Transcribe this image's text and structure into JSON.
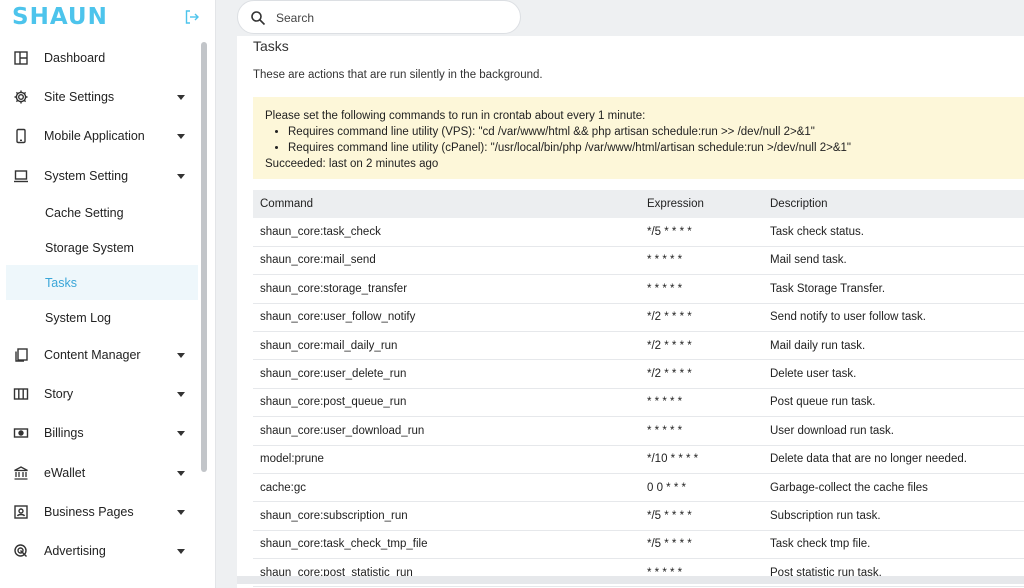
{
  "app": {
    "logo_text": "SHAUN",
    "accent_color": "#4dc4ec",
    "active_color": "#3aa6d8"
  },
  "search": {
    "placeholder": "Search",
    "icon": "search-icon"
  },
  "sidebar": {
    "items": [
      {
        "label": "Dashboard",
        "icon": "dashboard-icon",
        "has_caret": false
      },
      {
        "label": "Site Settings",
        "icon": "gear-icon",
        "has_caret": true
      },
      {
        "label": "Mobile Application",
        "icon": "mobile-icon",
        "has_caret": true
      },
      {
        "label": "System Setting",
        "icon": "laptop-icon",
        "has_caret": true,
        "expanded": true
      },
      {
        "label": "Content Manager",
        "icon": "copy-icon",
        "has_caret": true
      },
      {
        "label": "Story",
        "icon": "columns-icon",
        "has_caret": true
      },
      {
        "label": "Billings",
        "icon": "money-icon",
        "has_caret": true
      },
      {
        "label": "eWallet",
        "icon": "bank-icon",
        "has_caret": true
      },
      {
        "label": "Business Pages",
        "icon": "id-card-icon",
        "has_caret": true
      },
      {
        "label": "Advertising",
        "icon": "target-icon",
        "has_caret": true
      }
    ],
    "system_setting_children": [
      {
        "label": "Cache Setting",
        "active": false
      },
      {
        "label": "Storage System",
        "active": false
      },
      {
        "label": "Tasks",
        "active": true
      },
      {
        "label": "System Log",
        "active": false
      }
    ]
  },
  "page": {
    "title": "Tasks",
    "description": "These are actions that are run silently in the background.",
    "notice": {
      "intro": "Please set the following commands to run in crontab about every 1 minute:",
      "bullets": [
        "Requires command line utility (VPS): \"cd /var/www/html && php artisan schedule:run >> /dev/null 2>&1\"",
        "Requires command line utility (cPanel): \"/usr/local/bin/php /var/www/html/artisan schedule:run >/dev/null 2>&1\""
      ],
      "status": "Succeeded: last on 2 minutes ago"
    }
  },
  "table": {
    "headers": [
      "Command",
      "Expression",
      "Description"
    ],
    "rows": [
      [
        "shaun_core:task_check",
        "*/5 * * * *",
        "Task check status."
      ],
      [
        "shaun_core:mail_send",
        "* * * * *",
        "Mail send task."
      ],
      [
        "shaun_core:storage_transfer",
        "* * * * *",
        "Task Storage Transfer."
      ],
      [
        "shaun_core:user_follow_notify",
        "*/2 * * * *",
        "Send notify to user follow task."
      ],
      [
        "shaun_core:mail_daily_run",
        "*/2 * * * *",
        "Mail daily run task."
      ],
      [
        "shaun_core:user_delete_run",
        "*/2 * * * *",
        "Delete user task."
      ],
      [
        "shaun_core:post_queue_run",
        "* * * * *",
        "Post queue run task."
      ],
      [
        "shaun_core:user_download_run",
        "* * * * *",
        "User download run task."
      ],
      [
        "model:prune",
        "*/10 * * * *",
        "Delete data that are no longer needed."
      ],
      [
        "cache:gc",
        "0 0 * * *",
        "Garbage-collect the cache files"
      ],
      [
        "shaun_core:subscription_run",
        "*/5 * * * *",
        "Subscription run task."
      ],
      [
        "shaun_core:task_check_tmp_file",
        "*/5 * * * *",
        "Task check tmp file."
      ],
      [
        "shaun_core:post_statistic_run",
        "* * * * *",
        "Post statistic run task."
      ]
    ]
  }
}
